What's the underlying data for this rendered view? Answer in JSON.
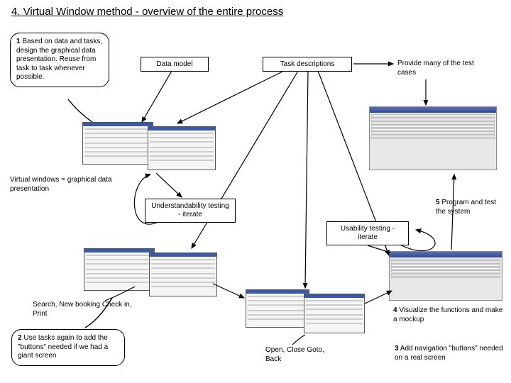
{
  "title": "4. Virtual Window method - overview of the entire process",
  "step1": {
    "num": "1",
    "text": " Based on data and tasks, design the graphical data presentation. Reuse from task to task whenever possible."
  },
  "data_model": "Data model",
  "task_descriptions": "Task descriptions",
  "provide_tests": "Provide many of the test cases",
  "vw_label": "Virtual windows = graphical data presentation",
  "understandability": "Understandability testing - iterate",
  "usability": "Usability testing - iterate",
  "step5": {
    "num": "5",
    "text": " Program and test the system"
  },
  "search_label": "Search, New booking Check in, Print",
  "step4": "4 Visualize the functions and make a mockup",
  "step2": {
    "num": "2",
    "text": " Use tasks again to add the \"buttons\" needed if we had a giant screen"
  },
  "open_close": "Open, Close Goto, Back",
  "step3": "3 Add navigation \"buttons\" needed on a real screen"
}
